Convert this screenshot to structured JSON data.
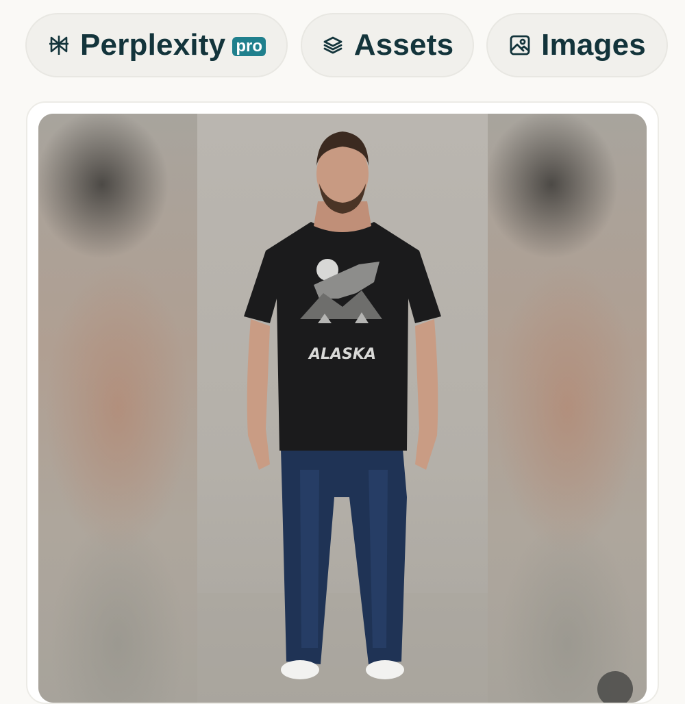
{
  "tabs": [
    {
      "label": "Perplexity",
      "badge": "pro",
      "icon": "perplexity-logo-icon"
    },
    {
      "label": "Assets",
      "icon": "layers-icon"
    },
    {
      "label": "Images",
      "icon": "image-icon"
    }
  ],
  "colors": {
    "text": "#13343b",
    "badge": "#20808d",
    "pill_bg": "#f1f0ec",
    "page_bg": "#faf9f6"
  },
  "photo": {
    "shirt_text": "ALASKA"
  }
}
